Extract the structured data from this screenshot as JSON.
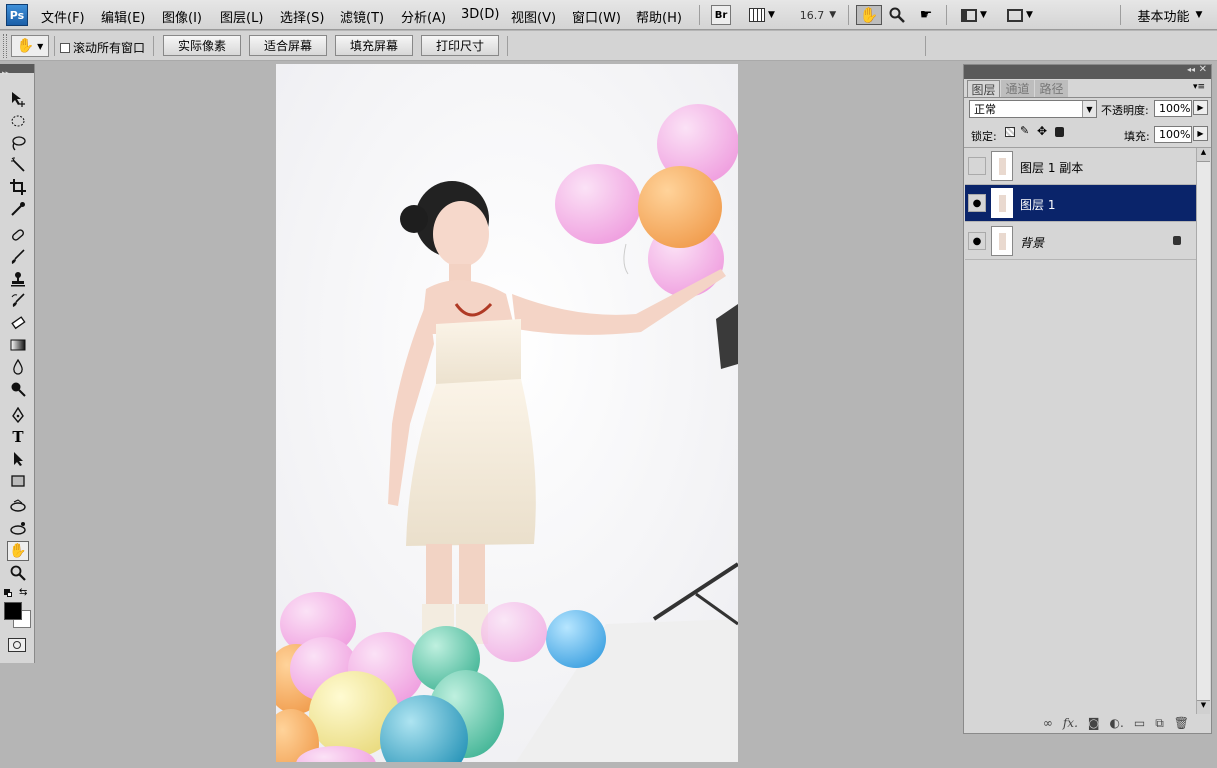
{
  "app": {
    "logo": "Ps"
  },
  "menu": [
    "文件(F)",
    "编辑(E)",
    "图像(I)",
    "图层(L)",
    "选择(S)",
    "滤镜(T)",
    "分析(A)",
    "3D(D)",
    "视图(V)",
    "窗口(W)",
    "帮助(H)"
  ],
  "app_bar": {
    "bridge": "Br",
    "zoom": "16.7",
    "workspace": "基本功能"
  },
  "options": {
    "scroll_all_label": "滚动所有窗口",
    "buttons": [
      "实际像素",
      "适合屏幕",
      "填充屏幕",
      "打印尺寸"
    ]
  },
  "tools": [
    "move-tool",
    "marquee-tool",
    "lasso-tool",
    "magic-wand-tool",
    "crop-tool",
    "eyedropper-tool",
    "healing-brush-tool",
    "brush-tool",
    "clone-stamp-tool",
    "history-brush-tool",
    "eraser-tool",
    "gradient-tool",
    "blur-tool",
    "dodge-tool",
    "pen-tool",
    "type-tool",
    "path-selection-tool",
    "shape-tool",
    "3d-rotate-tool",
    "3d-orbit-tool",
    "hand-tool",
    "zoom-tool"
  ],
  "colors": {
    "foreground": "#000000",
    "background": "#ffffff",
    "selection": "#0a246a"
  },
  "layers_panel": {
    "tabs": [
      "图层",
      "通道",
      "路径"
    ],
    "blend_mode": "正常",
    "opacity_label": "不透明度:",
    "opacity": "100%",
    "lock_label": "锁定:",
    "fill_label": "填充:",
    "fill": "100%",
    "layers": [
      {
        "name": "图层 1 副本",
        "visible": false,
        "selected": false,
        "locked": false
      },
      {
        "name": "图层 1",
        "visible": true,
        "selected": true,
        "locked": false
      },
      {
        "name": "背景",
        "visible": true,
        "selected": false,
        "locked": true
      }
    ]
  }
}
